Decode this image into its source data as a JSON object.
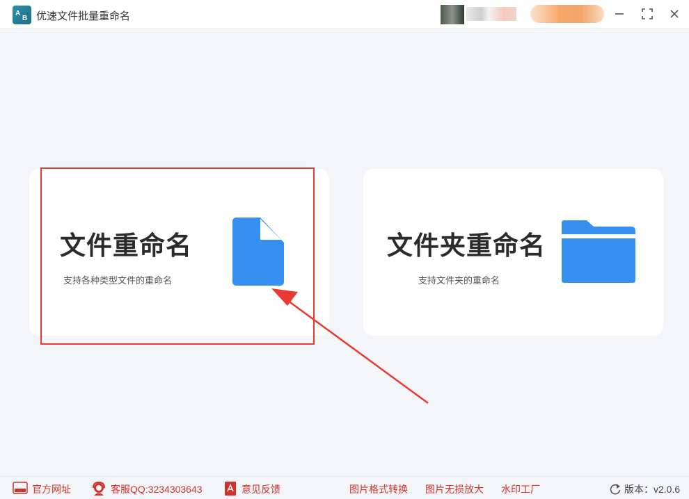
{
  "app": {
    "title": "优速文件批量重命名",
    "logo_letters": [
      "A",
      "B"
    ]
  },
  "cards": {
    "file": {
      "title": "文件重命名",
      "description": "支持各种类型文件的重命名",
      "icon": "file-icon"
    },
    "folder": {
      "title": "文件夹重命名",
      "description": "支持文件夹的重命名",
      "icon": "folder-icon"
    }
  },
  "footer": {
    "website": "官方网址",
    "support": "客服QQ:3234303643",
    "feedback": "意见反馈",
    "image_convert": "图片格式转换",
    "image_enlarge": "图片无损放大",
    "watermark": "水印工厂",
    "version": "版本：v2.0.6"
  },
  "colors": {
    "accent_blue": "#3690ef",
    "footer_red": "#d0332b",
    "annotation_red": "#e83a30"
  }
}
